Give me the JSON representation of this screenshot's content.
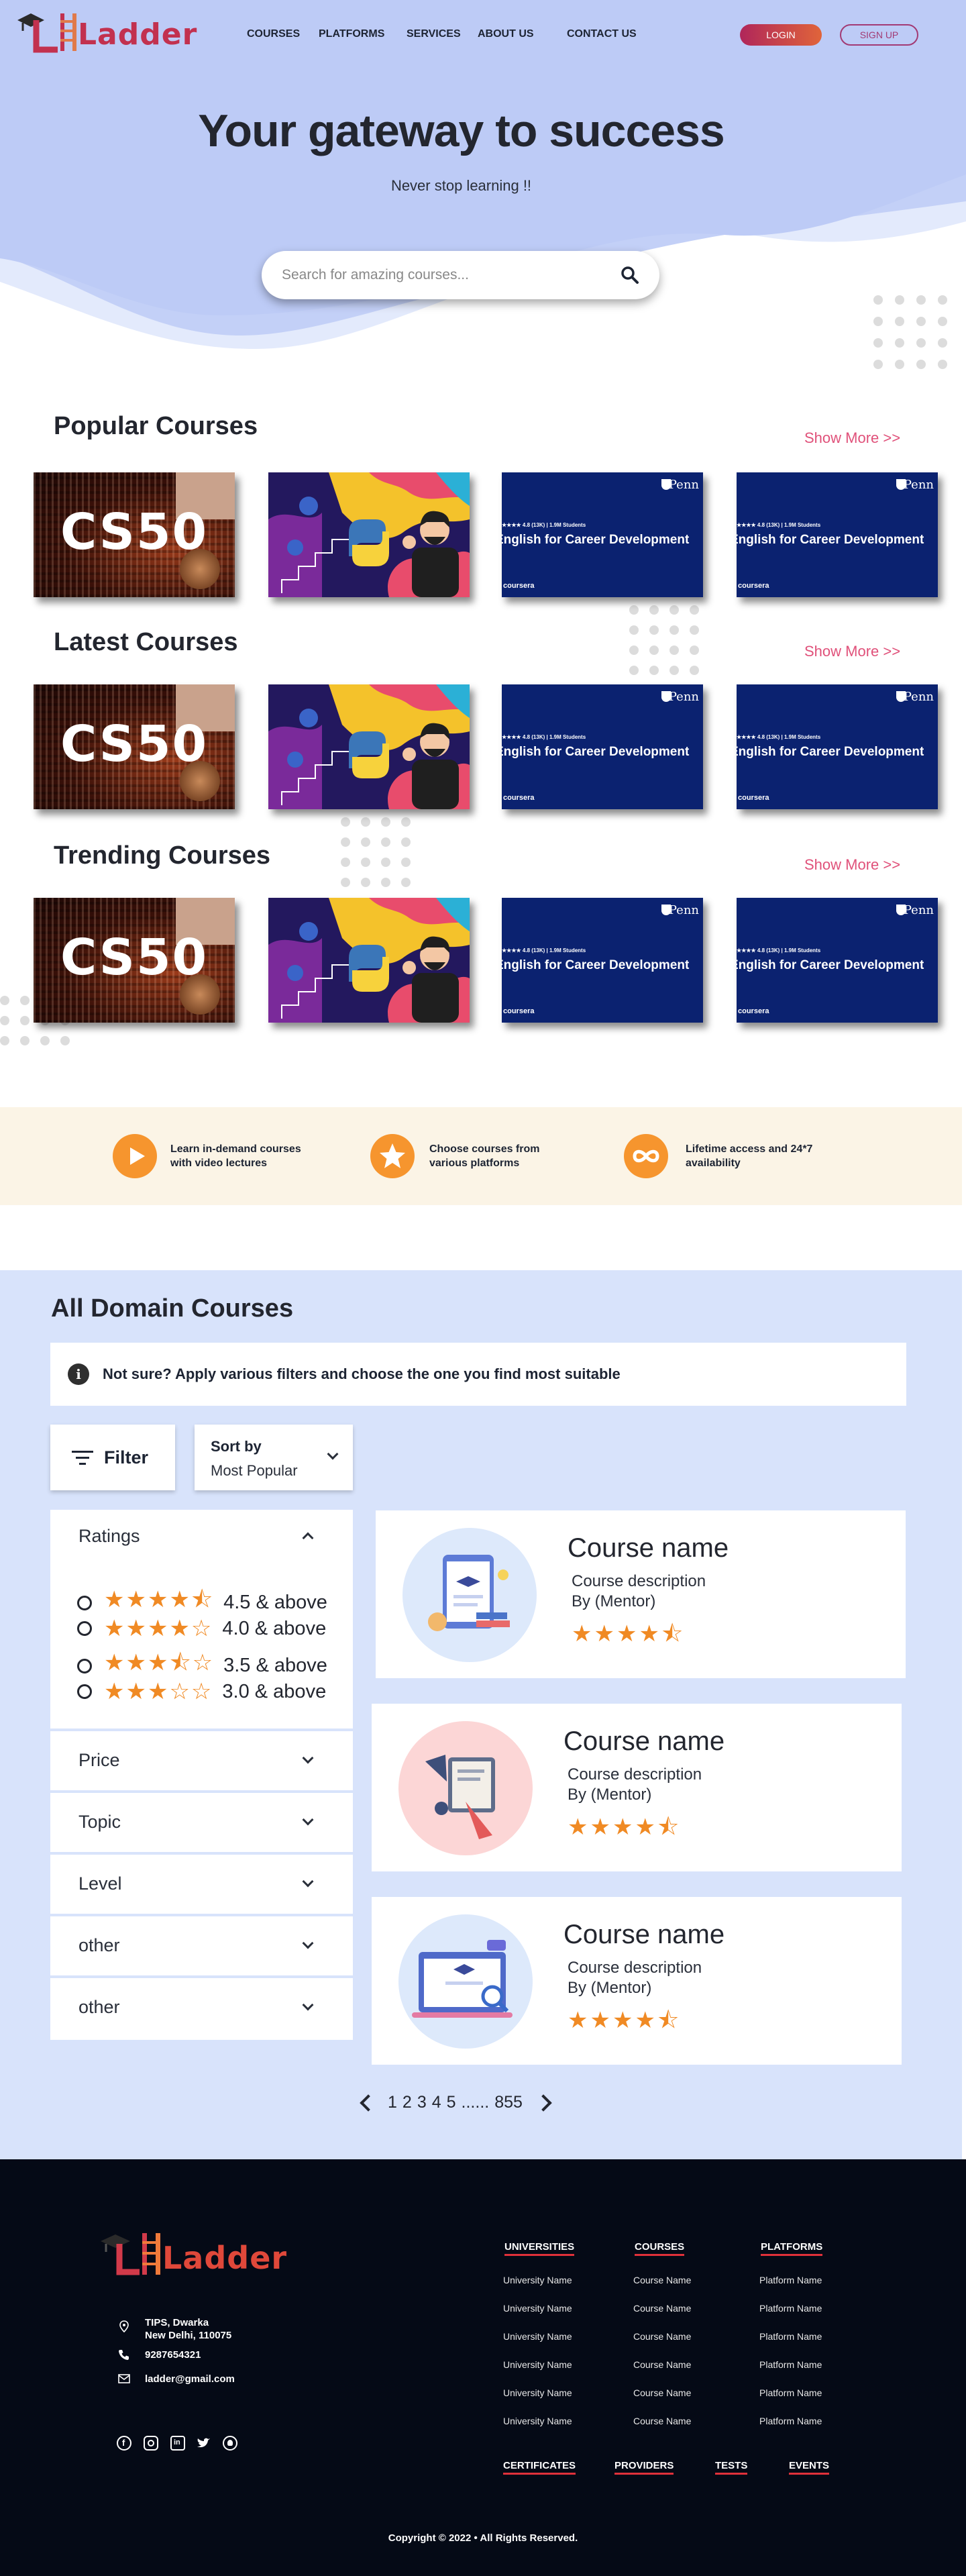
{
  "brand": {
    "name": "Ladder",
    "accent": "#e0517a",
    "primary": "#c7d4f8"
  },
  "nav": {
    "links": [
      "COURSES",
      "PLATFORMS",
      "SERVICES",
      "ABOUT US",
      "CONTACT US"
    ],
    "login": "LOGIN",
    "signup": "SIGN UP"
  },
  "hero": {
    "title": "Your gateway to success",
    "subtitle": "Never stop learning !!",
    "search_placeholder": "Search for amazing courses..."
  },
  "sections": [
    {
      "title": "Popular Courses",
      "show_more": "Show More >>"
    },
    {
      "title": "Latest Courses",
      "show_more": "Show More >>"
    },
    {
      "title": "Trending Courses",
      "show_more": "Show More >>"
    }
  ],
  "thumbs": {
    "cs50": "CS50",
    "en_meta": "★★★★ 4.8 (13K) | 1.9M Students",
    "en_title": "English for Career Development",
    "en_platform": "coursera",
    "en_logo": "Penn"
  },
  "features": [
    {
      "text": "Learn in-demand courses\nwith video lectures",
      "icon": "play-icon"
    },
    {
      "text": "Choose courses from\nvarious platforms",
      "icon": "star-icon"
    },
    {
      "text": "Lifetime access and 24*7\navailability",
      "icon": "infinity-icon"
    }
  ],
  "domain": {
    "title": "All Domain Courses",
    "info": "Not sure? Apply various filters and choose the one you find most suitable",
    "filter_label": "Filter",
    "sort_label": "Sort by",
    "sort_value": "Most Popular",
    "ratings_label": "Ratings",
    "ratings": [
      {
        "stars": "★★★★⯪",
        "label": "4.5 & above",
        "value": 4.5
      },
      {
        "stars": "★★★★☆",
        "label": "4.0 & above",
        "value": 4.0
      },
      {
        "stars": "★★★⯪☆",
        "label": "3.5 & above",
        "value": 3.5
      },
      {
        "stars": "★★★☆☆",
        "label": "3.0 & above",
        "value": 3.0
      }
    ],
    "filter_groups": [
      "Price",
      "Topic",
      "Level",
      "other",
      "other"
    ],
    "courses": [
      {
        "name": "Course name",
        "desc": "Course description",
        "mentor": "By (Mentor)",
        "stars": "★★★★⯪",
        "rating": 4.5
      },
      {
        "name": "Course name",
        "desc": "Course description",
        "mentor": "By (Mentor)",
        "stars": "★★★★⯪",
        "rating": 4.5
      },
      {
        "name": "Course name",
        "desc": "Course description",
        "mentor": "By (Mentor)",
        "stars": "★★★★⯪",
        "rating": 4.5
      }
    ],
    "pages": [
      "1",
      "2",
      "3",
      "4",
      "5",
      "......",
      "855"
    ]
  },
  "footer": {
    "address": "TIPS, Dwarka\nNew Delhi, 110075",
    "phone": "9287654321",
    "email": "ladder@gmail.com",
    "columns": [
      {
        "title": "UNIVERSITIES",
        "items": [
          "University Name",
          "University Name",
          "University Name",
          "University Name",
          "University Name",
          "University Name"
        ]
      },
      {
        "title": "COURSES",
        "items": [
          "Course Name",
          "Course Name",
          "Course Name",
          "Course Name",
          "Course Name",
          "Course Name"
        ]
      },
      {
        "title": "PLATFORMS",
        "items": [
          "Platform Name",
          "Platform Name",
          "Platform Name",
          "Platform Name",
          "Platform Name",
          "Platform Name"
        ]
      }
    ],
    "bottom_links": [
      "CERTIFICATES",
      "PROVIDERS",
      "TESTS",
      "EVENTS"
    ],
    "social": [
      "facebook-icon",
      "instagram-icon",
      "linkedin-icon",
      "twitter-icon",
      "github-icon"
    ],
    "copyright": "Copyright © 2022 • All Rights Reserved."
  }
}
